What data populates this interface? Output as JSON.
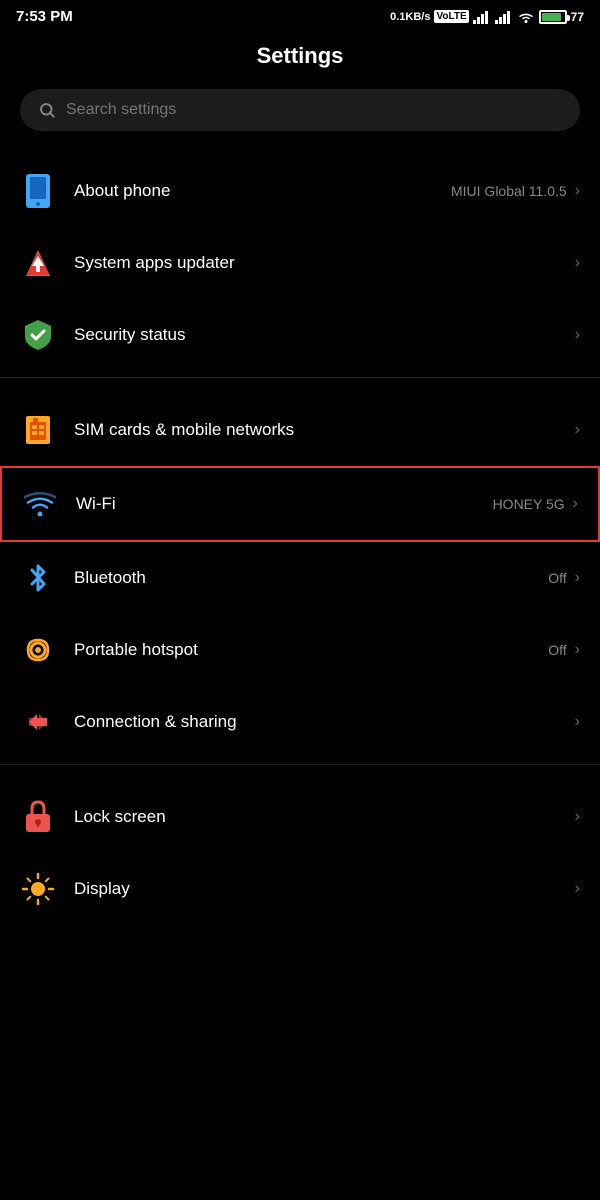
{
  "statusBar": {
    "time": "7:53 PM",
    "speed": "0.1KB/s",
    "network": "VoLTE",
    "battery": "77"
  },
  "header": {
    "title": "Settings"
  },
  "search": {
    "placeholder": "Search settings"
  },
  "sections": [
    {
      "items": [
        {
          "id": "about-phone",
          "label": "About phone",
          "value": "MIUI Global 11.0.5",
          "icon": "phone-icon"
        },
        {
          "id": "system-apps-updater",
          "label": "System apps updater",
          "value": "",
          "icon": "updater-icon"
        },
        {
          "id": "security-status",
          "label": "Security status",
          "value": "",
          "icon": "shield-icon"
        }
      ]
    },
    {
      "items": [
        {
          "id": "sim-cards",
          "label": "SIM cards & mobile networks",
          "value": "",
          "icon": "sim-icon"
        },
        {
          "id": "wifi",
          "label": "Wi-Fi",
          "value": "HONEY 5G",
          "icon": "wifi-icon",
          "highlighted": true
        },
        {
          "id": "bluetooth",
          "label": "Bluetooth",
          "value": "Off",
          "icon": "bluetooth-icon"
        },
        {
          "id": "hotspot",
          "label": "Portable hotspot",
          "value": "Off",
          "icon": "hotspot-icon"
        },
        {
          "id": "connection-sharing",
          "label": "Connection & sharing",
          "value": "",
          "icon": "connection-icon"
        }
      ]
    },
    {
      "items": [
        {
          "id": "lock-screen",
          "label": "Lock screen",
          "value": "",
          "icon": "lock-icon"
        },
        {
          "id": "display",
          "label": "Display",
          "value": "",
          "icon": "display-icon"
        }
      ]
    }
  ],
  "chevron": "›"
}
